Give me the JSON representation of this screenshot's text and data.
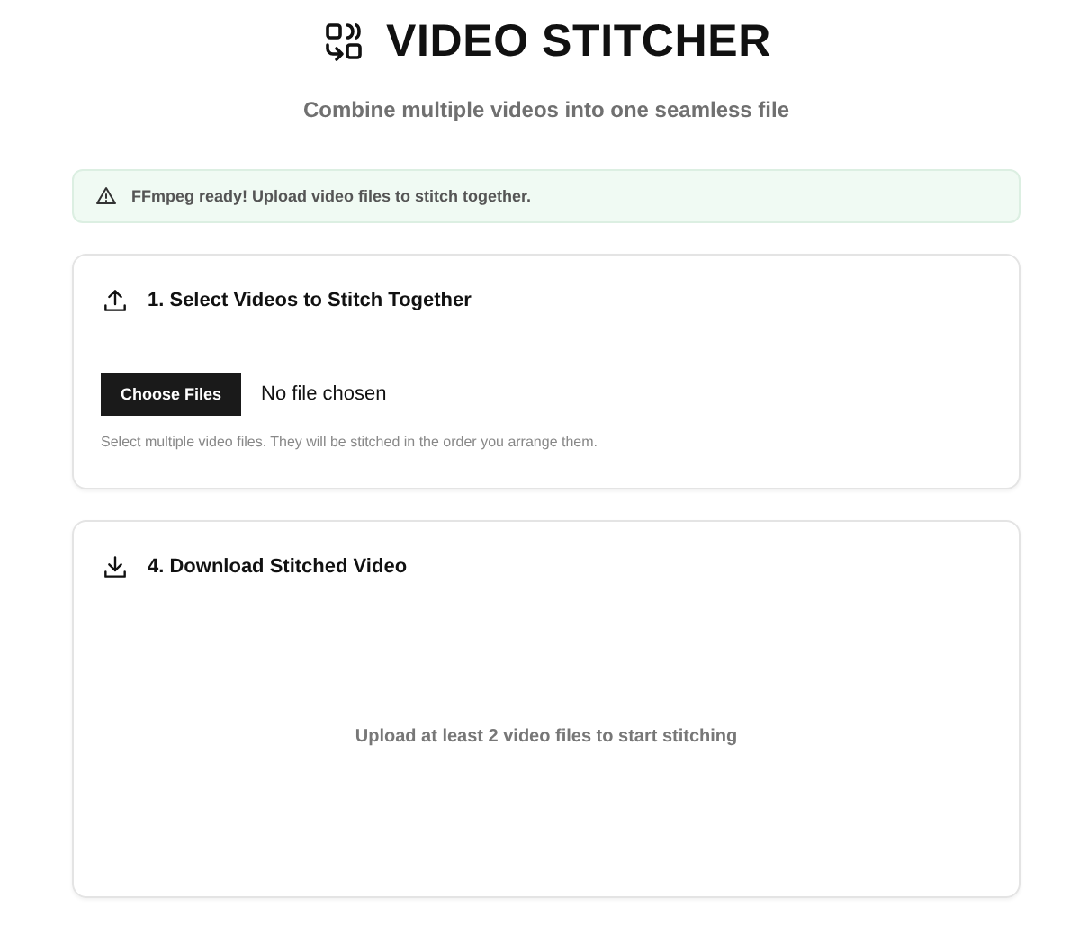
{
  "header": {
    "title": "VIDEO STITCHER",
    "subtitle": "Combine multiple videos into one seamless file"
  },
  "alert": {
    "text": "FFmpeg ready! Upload video files to stitch together."
  },
  "sections": [
    {
      "kind": "upload",
      "title": "1. Select Videos to Stitch Together",
      "button": "Choose Files",
      "file_status": "No file chosen",
      "hint": "Select multiple video files. They will be stitched in the order you arrange them."
    },
    {
      "kind": "download",
      "title": "4. Download Stitched Video",
      "empty_message": "Upload at least 2 video files to start stitching"
    }
  ]
}
